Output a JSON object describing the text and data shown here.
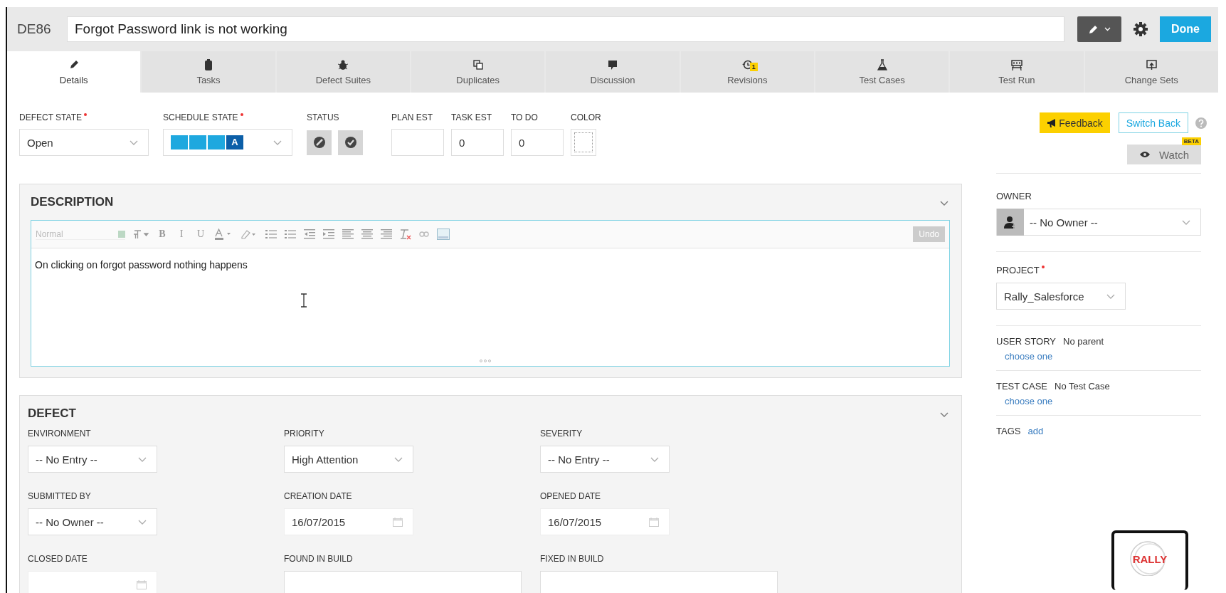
{
  "header": {
    "id": "DE86",
    "title": "Forgot Password link is not working",
    "done_label": "Done"
  },
  "tabs": [
    {
      "label": "Details",
      "kind": "pencil",
      "selected": true
    },
    {
      "label": "Tasks",
      "kind": "clipboard",
      "selected": false
    },
    {
      "label": "Defect Suites",
      "kind": "bug",
      "selected": false
    },
    {
      "label": "Duplicates",
      "kind": "duplicate",
      "selected": false
    },
    {
      "label": "Discussion",
      "kind": "bubble",
      "selected": false
    },
    {
      "label": "Revisions",
      "kind": "history",
      "badge": "1",
      "selected": false
    },
    {
      "label": "Test Cases",
      "kind": "flask",
      "selected": false
    },
    {
      "label": "Test Run",
      "kind": "easel",
      "selected": false
    },
    {
      "label": "Change Sets",
      "kind": "changeset",
      "selected": false
    }
  ],
  "fields": [
    {
      "kind": "select",
      "label": "DEFECT STATE",
      "required": true,
      "value": "Open"
    },
    {
      "kind": "schedule",
      "label": "SCHEDULE STATE",
      "required": true,
      "segments": [
        {
          "current": false
        },
        {
          "current": false
        },
        {
          "current": false
        },
        {
          "current": true,
          "label": "A"
        }
      ]
    },
    {
      "kind": "status",
      "label": "STATUS",
      "toggles": [
        {
          "kind": "blocked",
          "on": false
        },
        {
          "kind": "ready",
          "on": false
        }
      ]
    },
    {
      "kind": "input",
      "label": "PLAN EST"
    },
    {
      "kind": "input",
      "label": "TASK EST",
      "value": "0"
    },
    {
      "kind": "input",
      "label": "TO DO",
      "value": "0"
    },
    {
      "kind": "color",
      "label": "COLOR"
    }
  ],
  "description": {
    "title": "DESCRIPTION",
    "expanded": true,
    "toolbar": [
      {
        "kind": "style-select",
        "placeholder": "Normal"
      },
      {
        "kind": "font-size"
      },
      {
        "kind": "text",
        "label": "B"
      },
      {
        "kind": "text",
        "label": "I"
      },
      {
        "kind": "text",
        "label": "U"
      },
      {
        "kind": "font-color"
      },
      {
        "kind": "highlight"
      },
      {
        "kind": "ordered-list"
      },
      {
        "kind": "bullet-list"
      },
      {
        "kind": "outdent"
      },
      {
        "kind": "indent"
      },
      {
        "kind": "align-left"
      },
      {
        "kind": "align-center"
      },
      {
        "kind": "align-right"
      },
      {
        "kind": "clear-format"
      },
      {
        "kind": "link"
      },
      {
        "kind": "image"
      }
    ],
    "undo": {
      "label": "Undo",
      "disabled": true
    },
    "text": "On clicking on forgot password nothing happens"
  },
  "defect": {
    "title": "DEFECT",
    "expanded": true,
    "fields": [
      {
        "kind": "select",
        "label": "ENVIRONMENT",
        "value": "-- No Entry --"
      },
      {
        "kind": "select",
        "label": "PRIORITY",
        "value": "High Attention"
      },
      {
        "kind": "select",
        "label": "SEVERITY",
        "value": "-- No Entry --"
      },
      {
        "kind": "select",
        "label": "SUBMITTED BY",
        "value": "-- No Owner --"
      },
      {
        "kind": "date",
        "label": "CREATION DATE",
        "value": "16/07/2015"
      },
      {
        "kind": "date",
        "label": "OPENED DATE",
        "value": "16/07/2015"
      },
      {
        "kind": "date",
        "label": "CLOSED DATE"
      },
      {
        "kind": "input",
        "label": "FOUND IN BUILD"
      },
      {
        "kind": "input",
        "label": "FIXED IN BUILD"
      }
    ]
  },
  "sidebar": {
    "feedback": "Feedback",
    "switch_back": "Switch Back",
    "watch": "Watch",
    "watch_badge": "BETA",
    "owner": {
      "label": "OWNER",
      "value": "-- No Owner --"
    },
    "project": {
      "label": "PROJECT",
      "required": true,
      "value": "Rally_Salesforce"
    },
    "links": [
      {
        "label": "USER STORY",
        "value": "No parent",
        "link": "choose one"
      },
      {
        "label": "TEST CASE",
        "value": "No Test Case",
        "link": "choose one"
      }
    ],
    "tags": {
      "label": "TAGS",
      "link": "add"
    },
    "logo": "RALLY"
  }
}
